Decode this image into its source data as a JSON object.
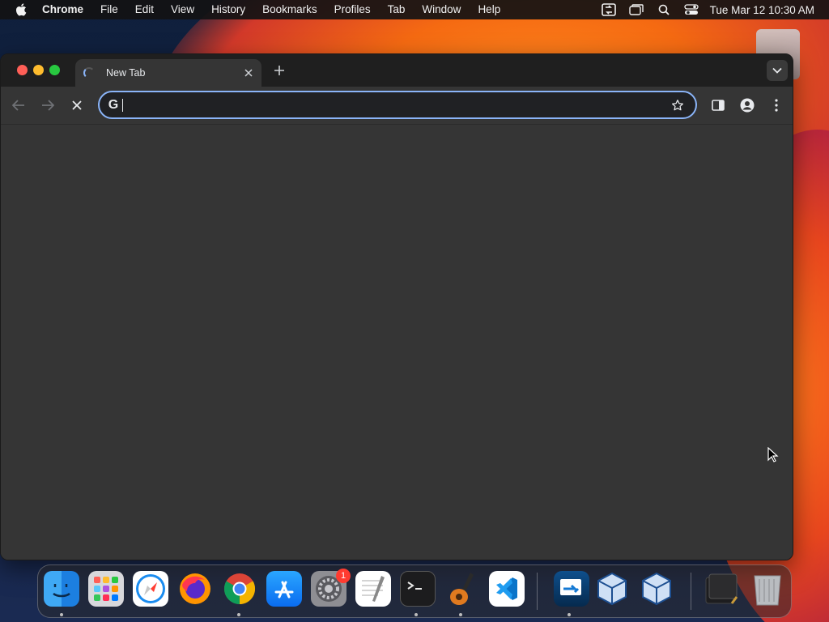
{
  "menubar": {
    "app_name": "Chrome",
    "items": [
      "File",
      "Edit",
      "View",
      "History",
      "Bookmarks",
      "Profiles",
      "Tab",
      "Window",
      "Help"
    ],
    "clock": "Tue Mar 12  10:30 AM",
    "status_icons": [
      "screen-mirror-icon",
      "window-icon",
      "spotlight-search-icon",
      "control-center-icon"
    ]
  },
  "browser": {
    "tab_title": "New Tab",
    "omnibox_value": "",
    "omnibox_placeholder": "",
    "accent_color": "#8ab4f8"
  },
  "dock": {
    "apps": [
      {
        "name": "Finder",
        "icon": "finder-icon",
        "running": true
      },
      {
        "name": "Launchpad",
        "icon": "launchpad-icon",
        "running": false
      },
      {
        "name": "Safari",
        "icon": "safari-icon",
        "running": false
      },
      {
        "name": "Firefox",
        "icon": "firefox-icon",
        "running": false
      },
      {
        "name": "Google Chrome",
        "icon": "chrome-icon",
        "running": true
      },
      {
        "name": "App Store",
        "icon": "app-store-icon",
        "running": false
      },
      {
        "name": "System Settings",
        "icon": "settings-icon",
        "running": false,
        "badge": "1"
      },
      {
        "name": "TextEdit",
        "icon": "textedit-icon",
        "running": false
      },
      {
        "name": "Terminal",
        "icon": "terminal-icon",
        "running": true
      },
      {
        "name": "GarageBand",
        "icon": "garageband-icon",
        "running": true
      },
      {
        "name": "Visual Studio Code",
        "icon": "vscode-icon",
        "running": false
      },
      {
        "name": "Remote Desktop",
        "icon": "remote-desktop-icon",
        "running": true
      },
      {
        "name": "VirtualBox",
        "icon": "virtualbox-icon",
        "running": false
      },
      {
        "name": "VirtualBox VM",
        "icon": "virtualbox-vm-icon",
        "running": false
      },
      {
        "name": "Downloads",
        "icon": "downloads-stack-icon",
        "running": false
      },
      {
        "name": "Trash",
        "icon": "trash-icon",
        "running": false
      }
    ]
  }
}
